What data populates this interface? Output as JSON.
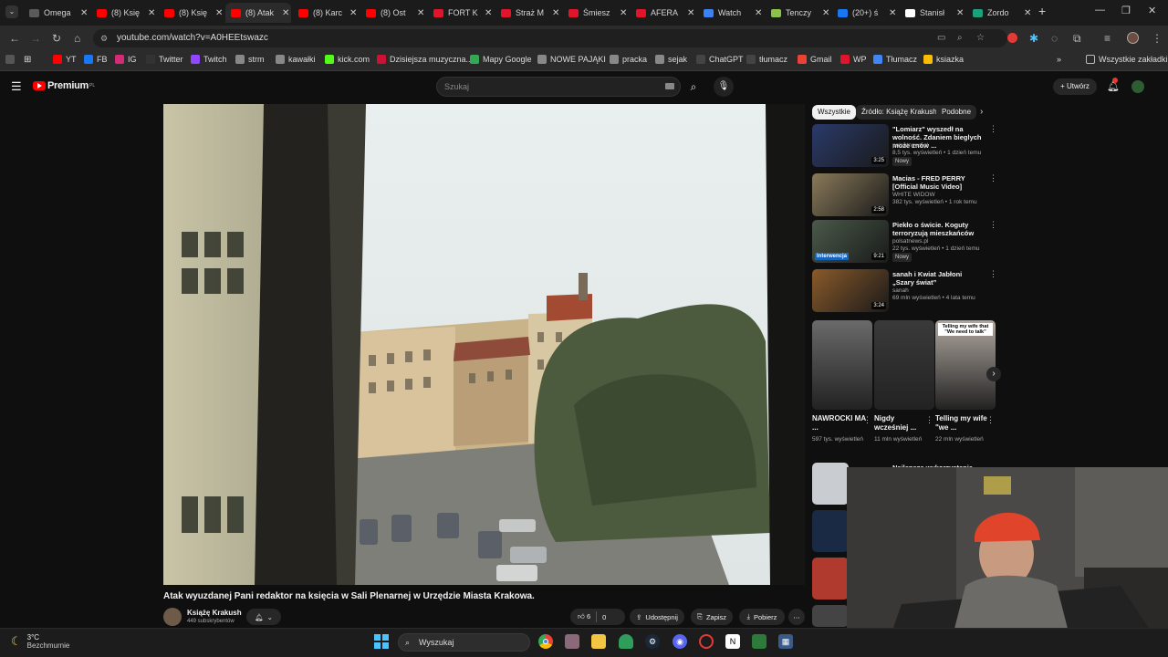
{
  "browser": {
    "tabs": [
      {
        "label": "Omega",
        "favicon_color": "#5a5a5a",
        "icon": "globe-icon"
      },
      {
        "label": "(8) Księ",
        "favicon_color": "#ff0000",
        "icon": "youtube-icon"
      },
      {
        "label": "(8) Księ",
        "favicon_color": "#ff0000",
        "icon": "youtube-icon"
      },
      {
        "label": "(8) Atak",
        "favicon_color": "#ff0000",
        "icon": "youtube-icon",
        "active": true
      },
      {
        "label": "(8) Karc",
        "favicon_color": "#ff0000",
        "icon": "youtube-icon"
      },
      {
        "label": "(8) Ost",
        "favicon_color": "#ff0000",
        "icon": "youtube-icon"
      },
      {
        "label": "FORT K",
        "favicon_color": "#e0142a",
        "icon": "news-icon"
      },
      {
        "label": "Straż M",
        "favicon_color": "#e0142a",
        "icon": "news-icon"
      },
      {
        "label": "Śmiesz",
        "favicon_color": "#e0142a",
        "icon": "news-icon"
      },
      {
        "label": "AFERA",
        "favicon_color": "#e0142a",
        "icon": "news-icon"
      },
      {
        "label": "Watch",
        "favicon_color": "#3b82f6",
        "icon": "watch-icon"
      },
      {
        "label": "Tenczy",
        "favicon_color": "#8bc34a",
        "icon": "site-icon"
      },
      {
        "label": "(20+) ś",
        "favicon_color": "#1877f2",
        "icon": "facebook-icon"
      },
      {
        "label": "Stanisł",
        "favicon_color": "#ffffff",
        "icon": "wikipedia-icon"
      },
      {
        "label": "Zordo",
        "favicon_color": "#1aa37a",
        "icon": "site-icon"
      }
    ],
    "url": "youtube.com/watch?v=A0HEEtswazc",
    "bookmarks": [
      {
        "label": "YT",
        "color": "#ff0000"
      },
      {
        "label": "FB",
        "color": "#1877f2"
      },
      {
        "label": "IG",
        "color": "#d62976"
      },
      {
        "label": "Twitter",
        "color": "#333333"
      },
      {
        "label": "Twitch",
        "color": "#9146ff"
      },
      {
        "label": "strm",
        "color": "#888888"
      },
      {
        "label": "kawałki",
        "color": "#888888"
      },
      {
        "label": "kick.com",
        "color": "#53fc18"
      },
      {
        "label": "Dzisiejsza muzyczna...",
        "color": "#cc1133"
      },
      {
        "label": "Mapy Google",
        "color": "#34a853"
      },
      {
        "label": "NOWE PAJĄKI",
        "color": "#888888"
      },
      {
        "label": "pracka",
        "color": "#888888"
      },
      {
        "label": "sejak",
        "color": "#888888"
      },
      {
        "label": "ChatGPT",
        "color": "#444444"
      },
      {
        "label": "tłumacz",
        "color": "#444444"
      },
      {
        "label": "Gmail",
        "color": "#ea4335"
      },
      {
        "label": "WP",
        "color": "#e0142a"
      },
      {
        "label": "Tłumacz",
        "color": "#4285f4"
      },
      {
        "label": "ksiazka",
        "color": "#fbbc05"
      }
    ],
    "all_bookmarks": "Wszystkie zakładki"
  },
  "youtube": {
    "logo": "Premium",
    "logo_sup": "PL",
    "search_placeholder": "Szukaj",
    "create_label": "Utwórz",
    "video_title": "Atak wyuzdanej Pani redaktor na księcia w Sali Plenarnej w Urzędzie Miasta Krakowa.",
    "channel": {
      "name": "Książę Krakush",
      "subs": "449 subskrybentów"
    },
    "likes": "6",
    "dislikes": "0",
    "actions": {
      "share": "Udostępnij",
      "save": "Zapisz",
      "download": "Pobierz"
    },
    "chips": [
      "Wszystkie",
      "Źródło: Książę Krakush",
      "Podobne"
    ],
    "recommendations": [
      {
        "title": "\"Lomiarz\" wyszedł na wolność. Zdaniem bieglych może znów ...",
        "channel": "polsatnews.pl",
        "meta": "8,5 tys. wyświetleń • 1 dzień temu",
        "badge": "Nowy",
        "duration": "3:25",
        "thumb": "#2a3a6a"
      },
      {
        "title": "Macias - FRED PERRY [Official Music Video]",
        "channel": "WHITE WIDOW",
        "meta": "382 tys. wyświetleń • 1 rok temu",
        "badge": "",
        "duration": "2:58",
        "thumb": "#8a7a5a"
      },
      {
        "title": "Piekło o świcie. Koguty terroryzują mieszkańców",
        "channel": "polsatnews.pl",
        "meta": "22 tys. wyświetleń • 1 dzień temu",
        "badge": "Nowy",
        "duration": "9:21",
        "thumb": "#4a5a4a",
        "thumb_label": "Interwencja"
      },
      {
        "title": "sanah i Kwiat Jabłoni „Szary świat”",
        "channel": "sanah",
        "meta": "69 mln wyświetleń • 4 lata temu",
        "badge": "",
        "duration": "3:24",
        "thumb": "#8a5a2a"
      }
    ],
    "shorts": [
      {
        "title": "NAWROCKI MA ...",
        "views": "597 tys. wyświetleń",
        "thumb": "#6a6a6a"
      },
      {
        "title": "Nigdy wcześniej ...",
        "views": "11 mln wyświetleń",
        "thumb": "#3a3a3a"
      },
      {
        "title": "Telling my wife \"we ...",
        "views": "22 mln wyświetleń",
        "thumb": "#b0a8a0",
        "caption": "Telling my wife that \"We need to talk\""
      }
    ],
    "partial_rec_title": "Najlepsze wykorzystanie ..."
  },
  "taskbar": {
    "weather_temp": "3°C",
    "weather_desc": "Bezchmurnie",
    "search_label": "Wyszukaj"
  }
}
